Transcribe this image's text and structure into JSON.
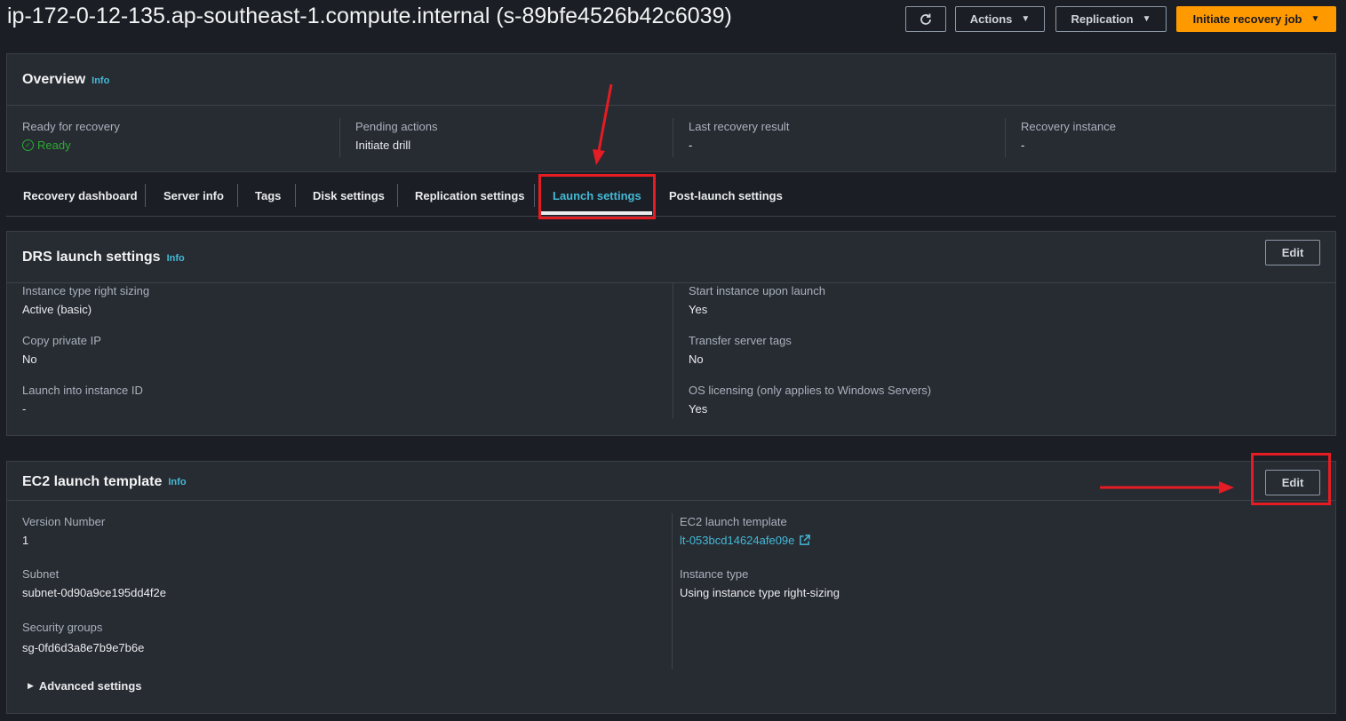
{
  "header": {
    "title": "ip-172-0-12-135.ap-southeast-1.compute.internal (s-89bfe4526b42c6039)",
    "refresh_icon": "refresh-icon",
    "actions_label": "Actions",
    "replication_label": "Replication",
    "initiate_label": "Initiate recovery job",
    "caret": "▼"
  },
  "overview": {
    "title": "Overview",
    "info": "Info",
    "ready_label": "Ready for recovery",
    "ready_value": "Ready",
    "pending_label": "Pending actions",
    "pending_value": "Initiate drill",
    "last_label": "Last recovery result",
    "last_value": "-",
    "instance_label": "Recovery instance",
    "instance_value": "-"
  },
  "tabs": [
    {
      "label": "Recovery dashboard"
    },
    {
      "label": "Server info"
    },
    {
      "label": "Tags"
    },
    {
      "label": "Disk settings"
    },
    {
      "label": "Replication settings"
    },
    {
      "label": "Launch settings"
    },
    {
      "label": "Post-launch settings"
    }
  ],
  "drs": {
    "title": "DRS launch settings",
    "info": "Info",
    "edit": "Edit",
    "right_sizing_label": "Instance type right sizing",
    "right_sizing_value": "Active (basic)",
    "copy_ip_label": "Copy private IP",
    "copy_ip_value": "No",
    "launch_into_label": "Launch into instance ID",
    "launch_into_value": "-",
    "start_label": "Start instance upon launch",
    "start_value": "Yes",
    "transfer_label": "Transfer server tags",
    "transfer_value": "No",
    "os_label": "OS licensing (only applies to Windows Servers)",
    "os_value": "Yes"
  },
  "ec2": {
    "title": "EC2 launch template",
    "info": "Info",
    "edit": "Edit",
    "version_label": "Version Number",
    "version_value": "1",
    "subnet_label": "Subnet",
    "subnet_value": "subnet-0d90a9ce195dd4f2e",
    "sg_label": "Security groups",
    "sg_value": "sg-0fd6d3a8e7b9e7b6e",
    "template_label": "EC2 launch template",
    "template_value": "lt-053bcd14624afe09e",
    "itype_label": "Instance type",
    "itype_value": "Using instance type right-sizing",
    "advanced_label": "Advanced settings"
  },
  "colors": {
    "accent": "#44b9d6",
    "primary": "#ff9900",
    "success": "#29ad32",
    "annotation": "#e51c23"
  }
}
